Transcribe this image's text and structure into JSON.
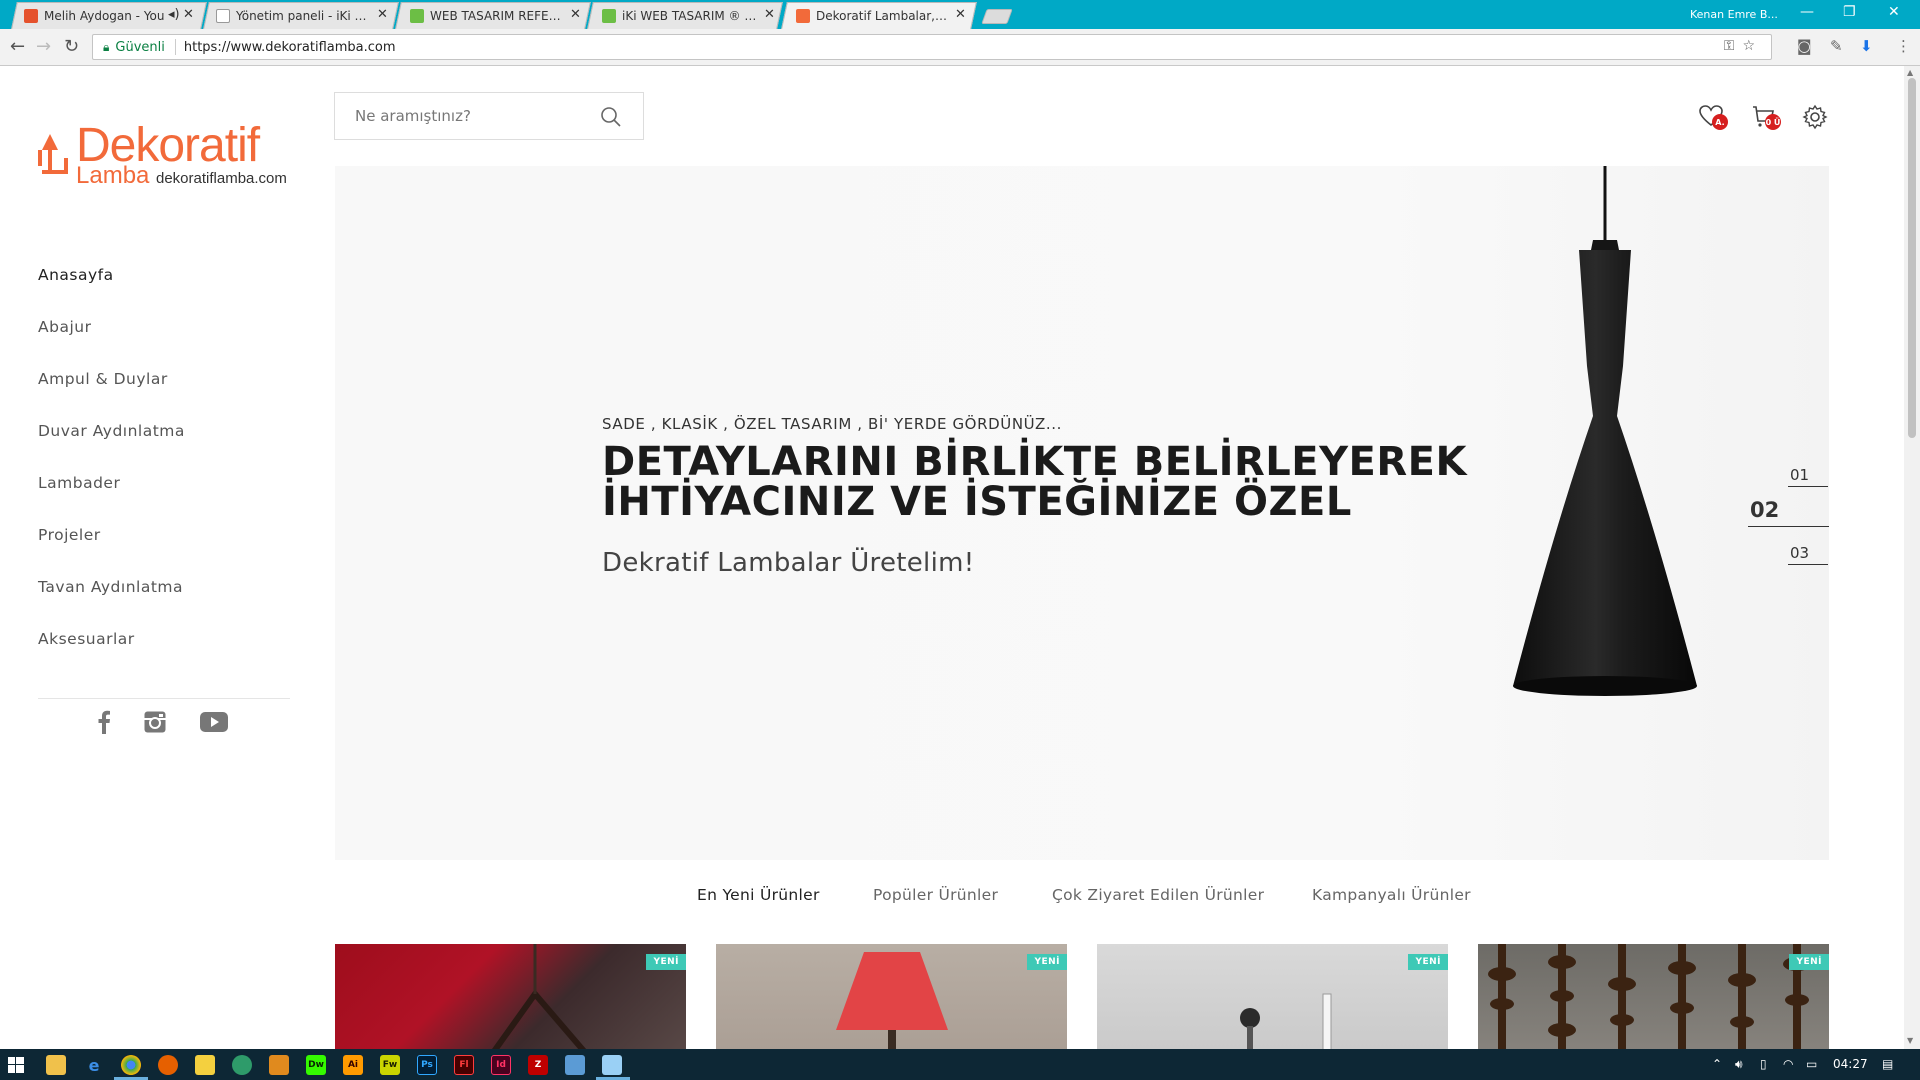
{
  "browser": {
    "tabs": [
      {
        "title": "Melih Aydogan - You",
        "favicon_color": "#e5522d"
      },
      {
        "title": "Yönetim paneli - iKi WEB",
        "favicon_color": "#bfbfbf"
      },
      {
        "title": "WEB TASARIM REFERANS",
        "favicon_color": "#6cbe45"
      },
      {
        "title": "iKi WEB TASARIM ® - We",
        "favicon_color": "#6cbe45"
      },
      {
        "title": "Dekoratif Lambalar,Deko",
        "favicon_color": "#f26a3a"
      }
    ],
    "profile_name": "Kenan Emre B...",
    "security_label": "Güvenli",
    "url": "https://www.dekoratiflamba.com"
  },
  "header": {
    "logo_main": "Dekoratif",
    "logo_sub": "Lamba",
    "logo_domain": "dekoratiflamba.com",
    "search_placeholder": "Ne aramıştınız?",
    "favorites_badge": "A.",
    "cart_badge": "0 Ü"
  },
  "sidebar": {
    "items": [
      {
        "label": "Anasayfa"
      },
      {
        "label": "Abajur"
      },
      {
        "label": "Ampul & Duylar"
      },
      {
        "label": "Duvar Aydınlatma"
      },
      {
        "label": "Lambader"
      },
      {
        "label": "Projeler"
      },
      {
        "label": "Tavan Aydınlatma"
      },
      {
        "label": "Aksesuarlar"
      }
    ],
    "social": [
      "facebook-icon",
      "instagram-icon",
      "youtube-icon"
    ]
  },
  "hero": {
    "kicker": "SADE , KLASİK , ÖZEL TASARIM , Bİ' YERDE GÖRDÜNÜZ...",
    "title_line1": "DETAYLARINI BİRLİKTE BELİRLEYEREK",
    "title_line2": "İHTİYACINIZ VE İSTEĞİNİZE ÖZEL",
    "subtitle": "Dekratif Lambalar Üretelim!",
    "slides": [
      "01",
      "02",
      "03"
    ],
    "active_slide": "02"
  },
  "product_tabs": [
    {
      "label": "En Yeni Ürünler"
    },
    {
      "label": "Popüler Ürünler"
    },
    {
      "label": "Çok Ziyaret Edilen Ürünler"
    },
    {
      "label": "Kampanyalı Ürünler"
    }
  ],
  "products": [
    {
      "badge": "YENİ"
    },
    {
      "badge": "YENİ"
    },
    {
      "badge": "YENİ"
    },
    {
      "badge": "YENİ"
    }
  ],
  "taskbar": {
    "clock": "04:27",
    "apps": [
      "explorer",
      "edge",
      "chrome",
      "firefox",
      "app",
      "app",
      "Dw",
      "Ai",
      "Fw",
      "Ps",
      "Fl",
      "Id",
      "filezilla",
      "app",
      "notepad"
    ]
  },
  "colors": {
    "brand": "#f26a3a",
    "chrome_frame": "#00a9c6",
    "badge_red": "#d61f1f",
    "new_badge": "#3ec9b6"
  }
}
